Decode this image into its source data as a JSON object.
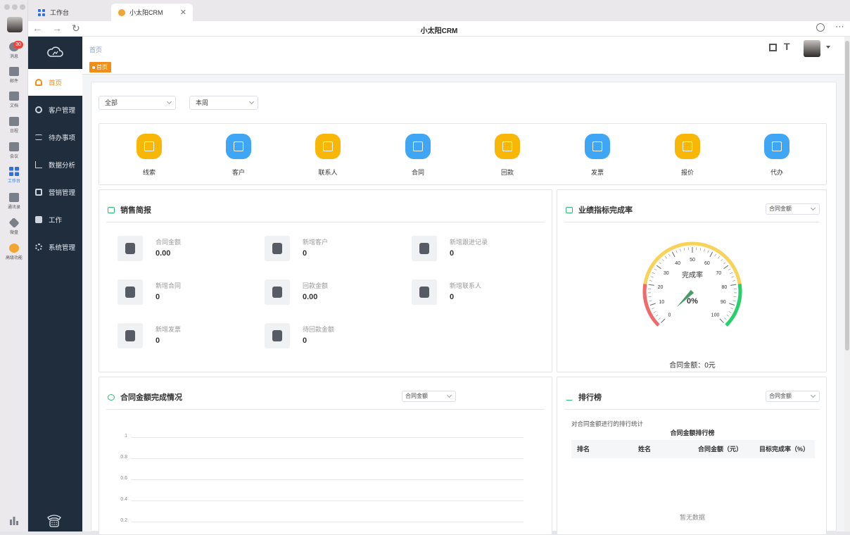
{
  "app_rail": {
    "items": [
      {
        "label": "消息",
        "icon": "message-icon",
        "badge": "30"
      },
      {
        "label": "邮件",
        "icon": "mail-icon"
      },
      {
        "label": "文档",
        "icon": "document-icon"
      },
      {
        "label": "日程",
        "icon": "calendar-icon"
      },
      {
        "label": "会议",
        "icon": "meeting-icon"
      },
      {
        "label": "工作台",
        "icon": "workbench-icon",
        "active": true
      },
      {
        "label": "通讯录",
        "icon": "contacts-icon"
      },
      {
        "label": "微盘",
        "icon": "drive-icon"
      },
      {
        "label": "高级功能",
        "icon": "advanced-icon"
      }
    ]
  },
  "tabs": [
    {
      "label": "工作台",
      "icon": "workbench-icon"
    },
    {
      "label": "小太阳CRM",
      "icon": "crm-logo-icon",
      "active": true
    }
  ],
  "window_title": "小太阳CRM",
  "sidebar": {
    "items": [
      {
        "label": "首页",
        "icon": "dashboard-icon",
        "active": true
      },
      {
        "label": "客户管理",
        "icon": "customer-icon"
      },
      {
        "label": "待办事项",
        "icon": "todo-icon"
      },
      {
        "label": "数据分析",
        "icon": "analysis-icon"
      },
      {
        "label": "营销管理",
        "icon": "marketing-icon"
      },
      {
        "label": "工作",
        "icon": "work-icon"
      },
      {
        "label": "系统管理",
        "icon": "settings-icon"
      }
    ]
  },
  "breadcrumb": "首页",
  "history_tag": "首页",
  "filters": {
    "scope": "全部",
    "period": "本周"
  },
  "quick_entries": [
    {
      "label": "线索",
      "color": "#f8b707"
    },
    {
      "label": "客户",
      "color": "#3fa6f5"
    },
    {
      "label": "联系人",
      "color": "#f8b707"
    },
    {
      "label": "合同",
      "color": "#3fa6f5"
    },
    {
      "label": "回款",
      "color": "#f8b707"
    },
    {
      "label": "发票",
      "color": "#3fa6f5"
    },
    {
      "label": "报价",
      "color": "#f8b707"
    },
    {
      "label": "代办",
      "color": "#3fa6f5"
    }
  ],
  "sales_brief": {
    "title": "销售简报",
    "stats": [
      {
        "label": "合同金额",
        "value": "0.00"
      },
      {
        "label": "新增客户",
        "value": "0"
      },
      {
        "label": "新增跟进记录",
        "value": "0"
      },
      {
        "label": "新增合同",
        "value": "0"
      },
      {
        "label": "回款金额",
        "value": "0.00"
      },
      {
        "label": "新增联系人",
        "value": "0"
      },
      {
        "label": "新增发票",
        "value": "0"
      },
      {
        "label": "待回款金额",
        "value": "0"
      }
    ]
  },
  "kpi": {
    "title": "业绩指标完成率",
    "select": "合同金额",
    "gauge_title": "完成率",
    "gauge_value": "0%",
    "gauge_percent": 0,
    "ticks": [
      "0",
      "10",
      "20",
      "30",
      "40",
      "50",
      "60",
      "70",
      "80",
      "90",
      "100"
    ],
    "footer": "合同金额：0元"
  },
  "contract_completion": {
    "title": "合同金额完成情况",
    "select": "合同金额",
    "chart_data": {
      "type": "line",
      "y_ticks": [
        "1",
        "0.8",
        "0.6",
        "0.4",
        "0.2"
      ],
      "series": []
    }
  },
  "ranking": {
    "title": "排行榜",
    "select": "合同金额",
    "subtitle": "对合同金额进行的排行统计",
    "table_title": "合同金额排行榜",
    "columns": [
      "排名",
      "姓名",
      "合同金额（元）",
      "目标完成率（%）"
    ],
    "empty": "暂无数据"
  },
  "colors": {
    "accent": "#f18e17",
    "sidebar": "#1f2d3d",
    "green": "#2bbc72",
    "gauge_red": "#f06a6a",
    "gauge_yellow": "#f7d35a",
    "gauge_green": "#27d06a",
    "needle": "#4a9a6a"
  }
}
